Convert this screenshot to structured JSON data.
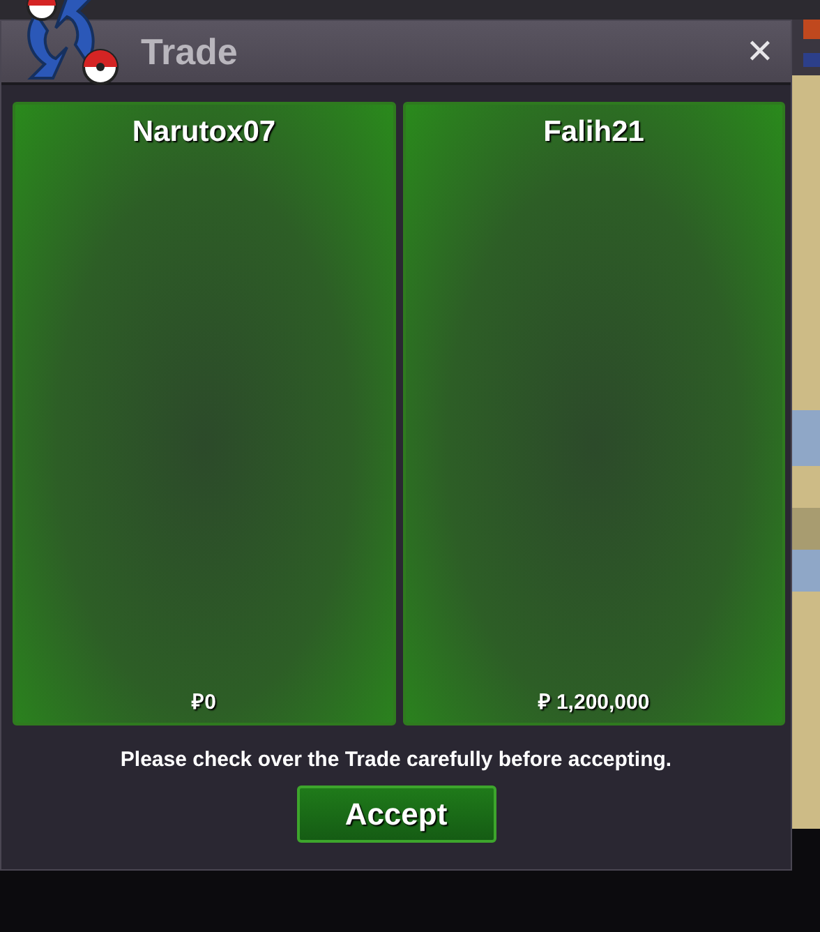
{
  "window": {
    "title": "Trade",
    "close": "✕"
  },
  "offers": [
    {
      "player": "Narutox07",
      "money": "₽0"
    },
    {
      "player": "Falih21",
      "money": "₽ 1,200,000"
    }
  ],
  "message": "Please check over the Trade carefully before accepting.",
  "buttons": [
    "Accept"
  ]
}
